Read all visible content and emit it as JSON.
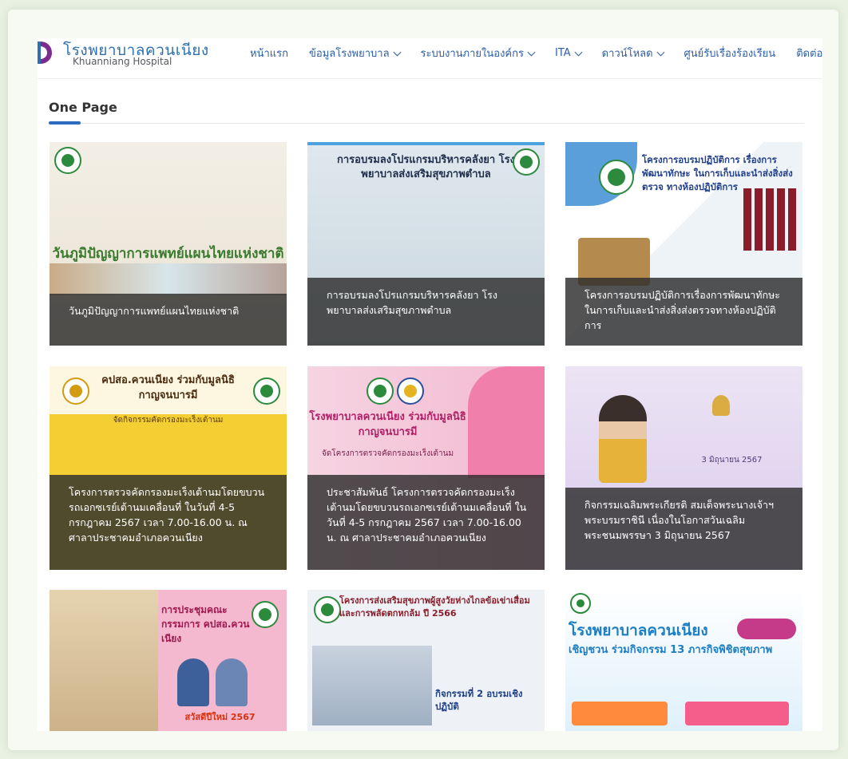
{
  "header": {
    "brand_th": "โรงพยาบาลควนเนียง",
    "brand_en": "Khuanniang Hospital",
    "nav": [
      {
        "label": "หน้าแรก",
        "dropdown": false
      },
      {
        "label": "ข้อมูลโรงพยาบาล",
        "dropdown": true
      },
      {
        "label": "ระบบงานภายในองค์กร",
        "dropdown": true
      },
      {
        "label": "ITA",
        "dropdown": true
      },
      {
        "label": "ดาวน์โหลด",
        "dropdown": true
      },
      {
        "label": "ศูนย์รับเรื่องร้องเรียน",
        "dropdown": false
      },
      {
        "label": "ติดต่อเรา",
        "dropdown": false
      }
    ]
  },
  "section": {
    "title": "One Page"
  },
  "cards": [
    {
      "image_text": "วันภูมิปัญญาการแพทย์แผนไทยแห่งชาติ",
      "caption": "วันภูมิปัญญาการแพทย์แผนไทยแห่งชาติ"
    },
    {
      "image_text": "การอบรมลงโปรแกรมบริหารคลังยา โรงพยาบาลส่งเสริมสุขภาพตำบล",
      "caption": "การอบรมลงโปรแกรมบริหารคลังยา โรงพยาบาลส่งเสริมสุขภาพตำบล"
    },
    {
      "image_text": "โครงการอบรมปฏิบัติการ เรื่องการพัฒนาทักษะ ในการเก็บและนำส่งสิ่งส่งตรวจ ทางห้องปฏิบัติการ",
      "caption": "โครงการอบรมปฏิบัติการเรื่องการพัฒนาทักษะในการเก็บและนำส่งสิ่งส่งตรวจทางห้องปฏิบัติการ"
    },
    {
      "image_text": "คปสอ.ควนเนียง ร่วมกับมูลนิธิกาญจนบารมี",
      "image_sub": "จัดกิจกรรมคัดกรองมะเร็งเต้านม",
      "caption": "โครงการตรวจคัดกรองมะเร็งเต้านมโดยขบวนรถเอกซเรย์เต้านมเคลื่อนที่ ในวันที่ 4-5 กรกฎาคม 2567 เวลา 7.00-16.00 น. ณ ศาลาประชาคมอำเภอควนเนียง"
    },
    {
      "image_text": "โรงพยาบาลควนเนียง ร่วมกับมูลนิธิกาญจนบารมี",
      "image_sub": "จัดโครงการตรวจคัดกรองมะเร็งเต้านม",
      "caption": "ประชาสัมพันธ์ โครงการตรวจคัดกรองมะเร็งเต้านมโดยขบวนรถเอกซเรย์เต้านมเคลื่อนที่ ในวันที่ 4-5 กรกฎาคม 2567 เวลา 7.00-16.00 น. ณ ศาลาประชาคมอำเภอควนเนียง"
    },
    {
      "image_text": "3 มิถุนายน 2567",
      "caption": "กิจกรรมเฉลิมพระเกียรติ สมเด็จพระนางเจ้าฯ พระบรมราชินี เนื่องในโอกาสวันเฉลิมพระชนมพรรษา 3 มิถุนายน 2567"
    },
    {
      "image_text": "การประชุมคณะกรรมการ คปสอ.ควนเนียง",
      "image_sub": "สวัสดีปีใหม่ 2567",
      "caption": ""
    },
    {
      "image_text": "โครงการส่งเสริมสุขภาพผู้สูงวัยห่างไกลข้อเข่าเสื่อม และการพลัดตกหกล้ม ปี 2566",
      "image_sub": "กิจกรรมที่ 2 อบรมเชิงปฏิบัติ",
      "caption": ""
    },
    {
      "image_text": "โรงพยาบาลควนเนียง",
      "image_sub": "เชิญชวน ร่วมกิจกรรม 13 ภารกิจพิชิตสุขภาพ",
      "caption": ""
    }
  ]
}
